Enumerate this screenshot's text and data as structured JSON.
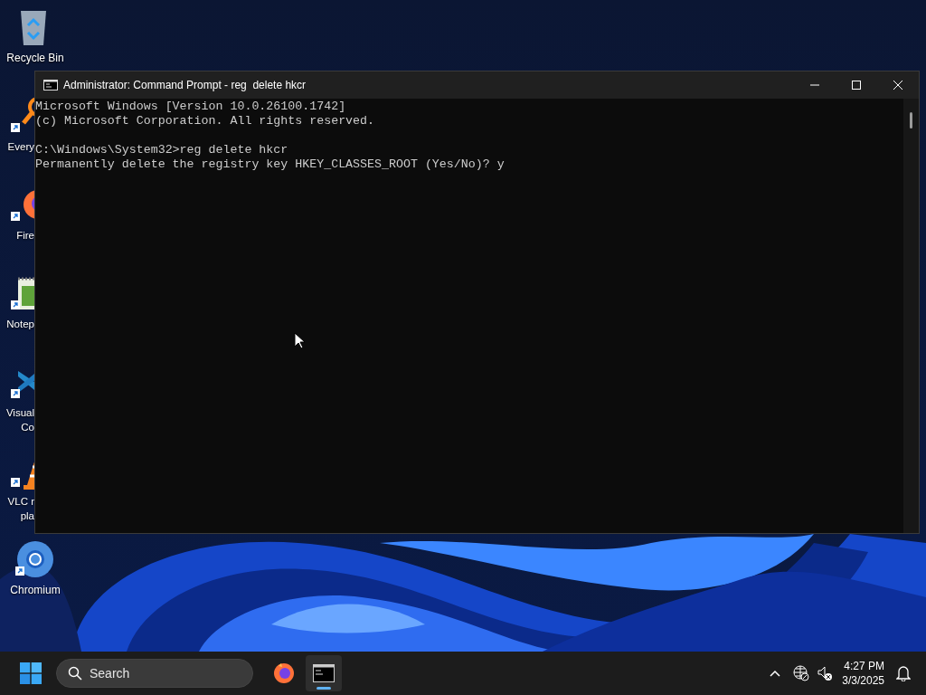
{
  "desktop_icons": [
    {
      "kind": "recycle-bin",
      "label_lines": [
        "Recycle Bin"
      ]
    },
    {
      "kind": "everything",
      "label_lines": [
        "Every"
      ]
    },
    {
      "kind": "firefox",
      "label_lines": [
        "Fire"
      ]
    },
    {
      "kind": "notepad",
      "label_lines": [
        "Notep"
      ]
    },
    {
      "kind": "vscode",
      "label_lines": [
        "Visual",
        "Co"
      ]
    },
    {
      "kind": "vlc",
      "label_lines": [
        "VLC r",
        "pla"
      ]
    },
    {
      "kind": "chromium",
      "label_lines": [
        "Chromium"
      ]
    }
  ],
  "window": {
    "title": "Administrator: Command Prompt - reg  delete hkcr",
    "console_blocks": [
      [
        "Microsoft Windows [Version 10.0.26100.1742]",
        "(c) Microsoft Corporation. All rights reserved."
      ],
      [
        "C:\\Windows\\System32>reg delete hkcr",
        "Permanently delete the registry key HKEY_CLASSES_ROOT (Yes/No)? y"
      ]
    ]
  },
  "taskbar": {
    "search": {
      "placeholder": "Search"
    },
    "apps": [
      {
        "kind": "firefox",
        "selected": false
      },
      {
        "kind": "terminal",
        "selected": true
      }
    ],
    "time": "4:27 PM",
    "date": "3/3/2025"
  }
}
